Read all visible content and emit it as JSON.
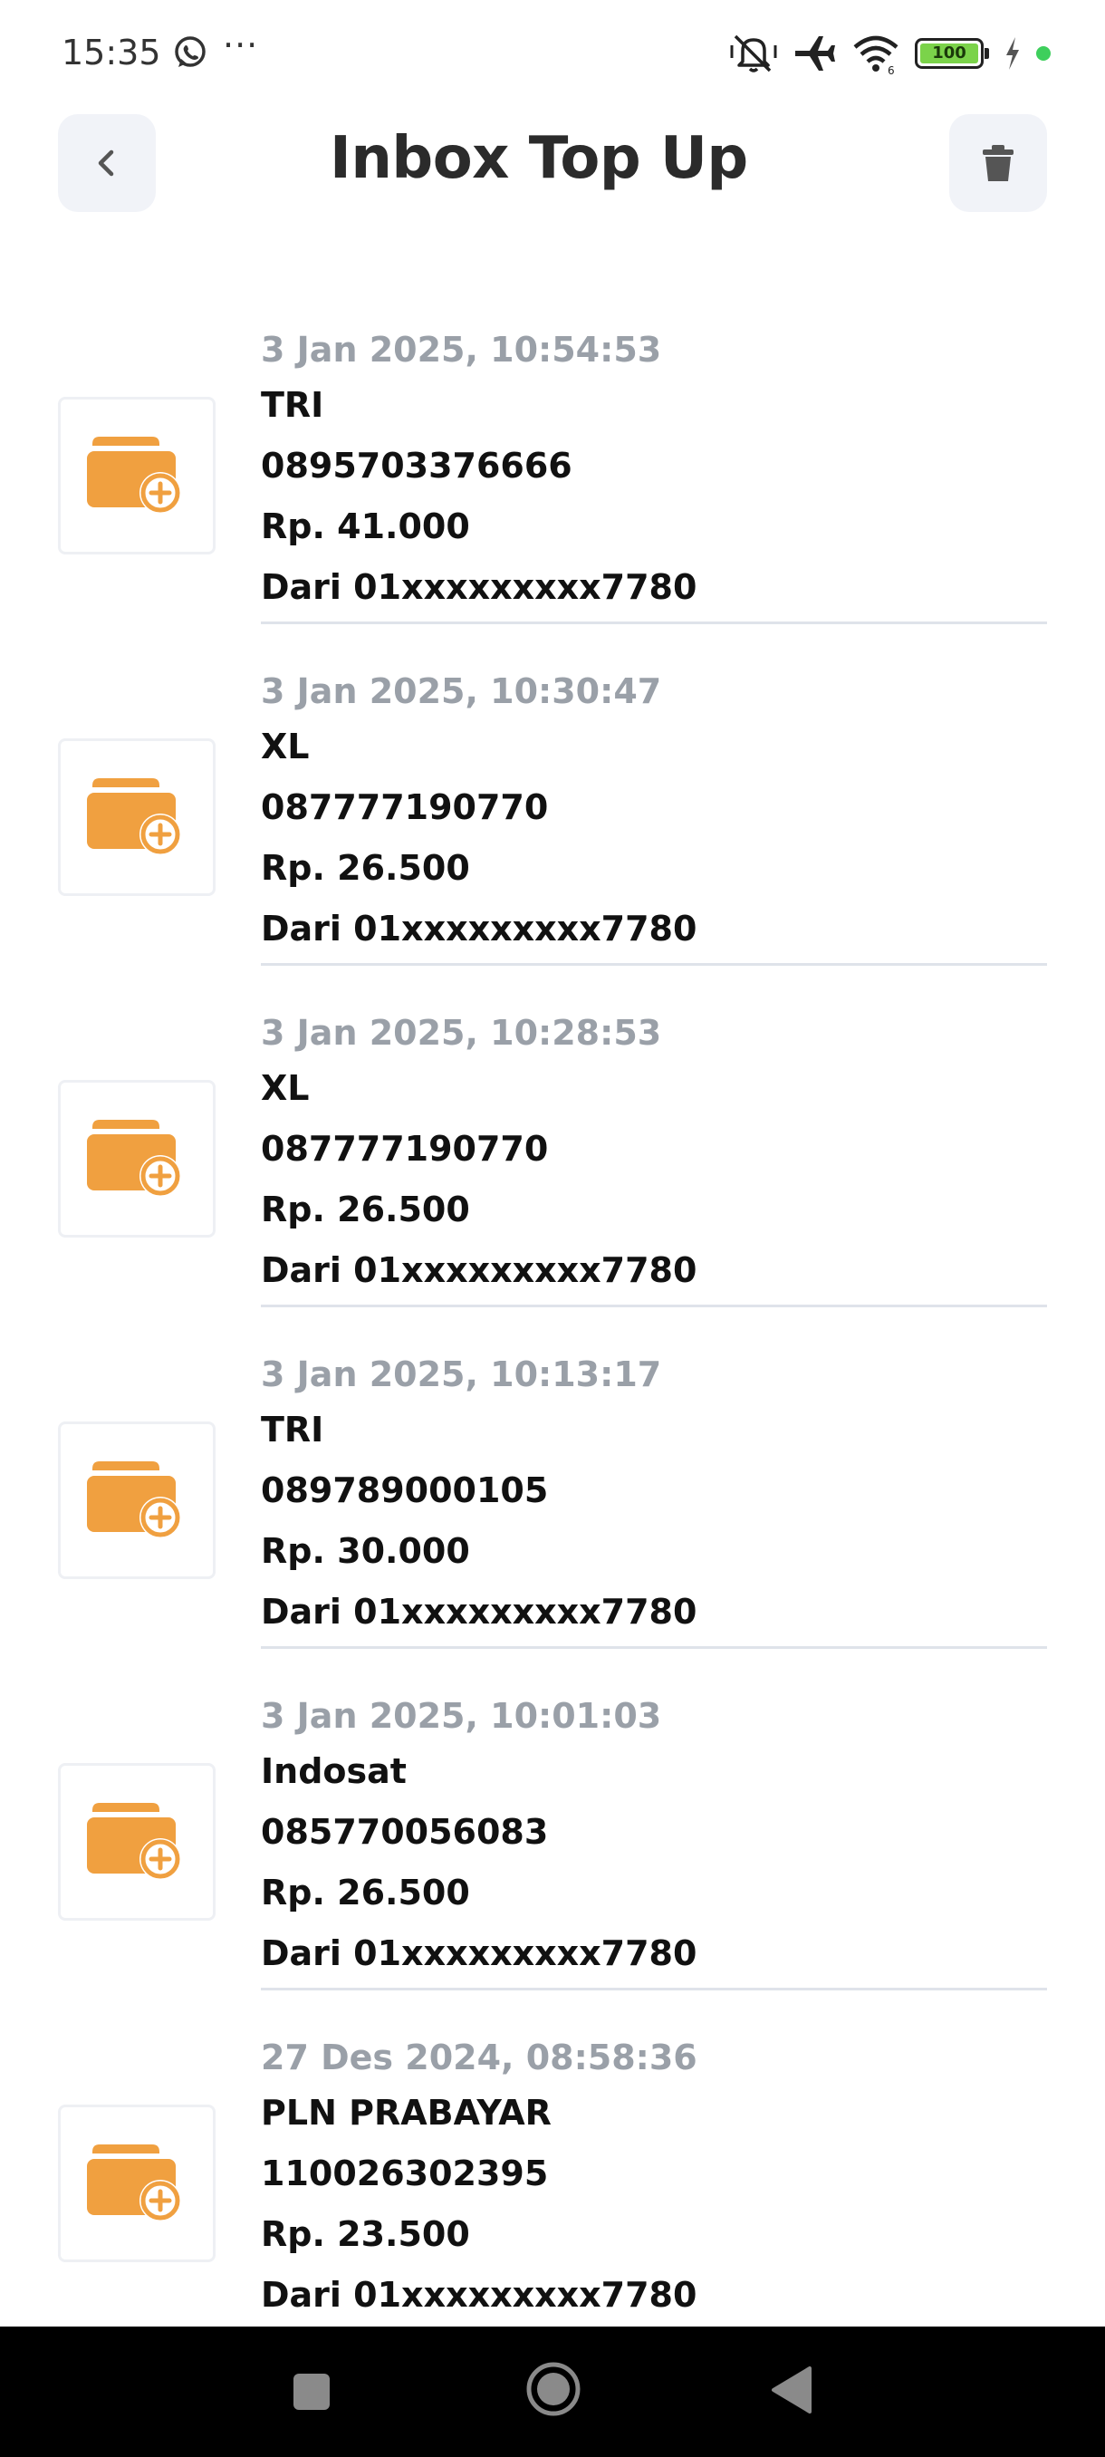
{
  "status_bar": {
    "time": "15:35",
    "more": "···",
    "battery": "100",
    "icons": [
      "whatsapp-icon",
      "mute-icon",
      "airplane-icon",
      "wifi-icon",
      "battery-icon",
      "charging-icon"
    ]
  },
  "header": {
    "title": "Inbox Top Up",
    "back_icon": "chevron-left-icon",
    "delete_icon": "trash-icon"
  },
  "colors": {
    "accent": "#F0A040",
    "date_text": "#9AA0A8",
    "button_bg": "#F1F3F8",
    "divider": "#DFE3EA"
  },
  "items": [
    {
      "date": "3 Jan 2025, 10:54:53",
      "provider": "TRI",
      "number": "0895703376666",
      "amount": "Rp. 41.000",
      "source": "Dari 01xxxxxxxxx7780"
    },
    {
      "date": "3 Jan 2025, 10:30:47",
      "provider": "XL",
      "number": "087777190770",
      "amount": "Rp. 26.500",
      "source": "Dari 01xxxxxxxxx7780"
    },
    {
      "date": "3 Jan 2025, 10:28:53",
      "provider": "XL",
      "number": "087777190770",
      "amount": "Rp. 26.500",
      "source": "Dari 01xxxxxxxxx7780"
    },
    {
      "date": "3 Jan 2025, 10:13:17",
      "provider": "TRI",
      "number": "089789000105",
      "amount": "Rp. 30.000",
      "source": "Dari 01xxxxxxxxx7780"
    },
    {
      "date": "3 Jan 2025, 10:01:03",
      "provider": "Indosat",
      "number": "085770056083",
      "amount": "Rp. 26.500",
      "source": "Dari 01xxxxxxxxx7780"
    },
    {
      "date": "27 Des 2024, 08:58:36",
      "provider": "PLN PRABAYAR",
      "number": "110026302395",
      "amount": "Rp. 23.500",
      "source": "Dari 01xxxxxxxxx7780"
    }
  ]
}
